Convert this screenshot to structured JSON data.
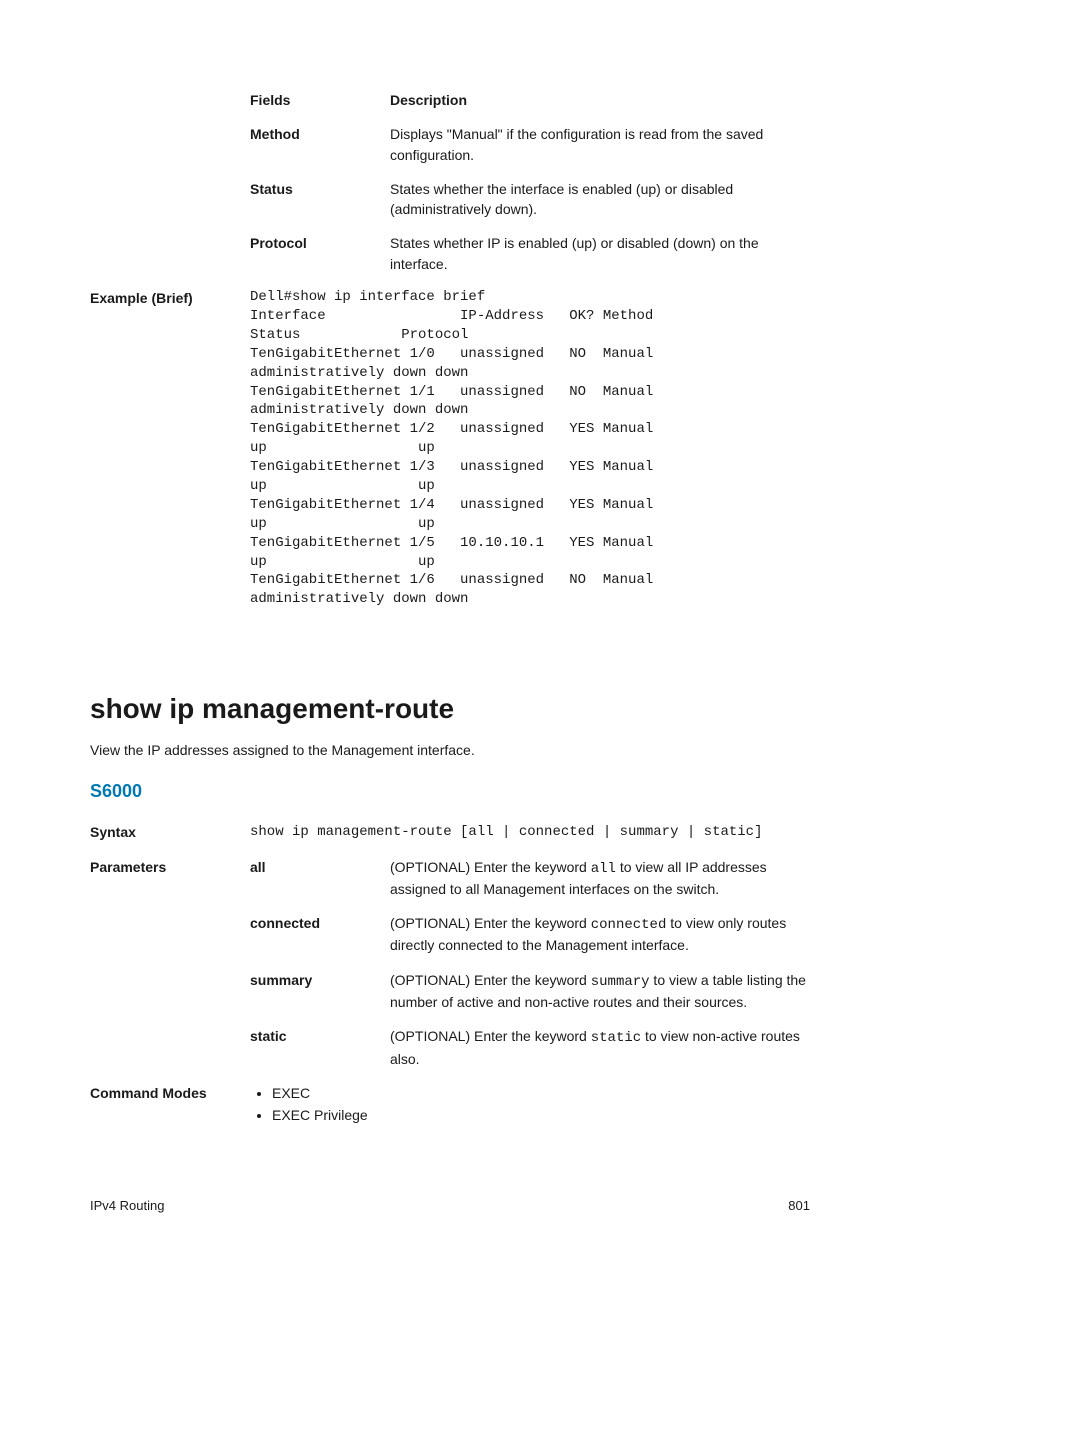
{
  "fields_table": {
    "header_fields": "Fields",
    "header_desc": "Description",
    "rows": [
      {
        "label": "Method",
        "desc": "Displays \"Manual\" if the configuration is read from the saved configuration."
      },
      {
        "label": "Status",
        "desc": "States whether the interface is enabled (up) or disabled (administratively down)."
      },
      {
        "label": "Protocol",
        "desc": "States whether IP is enabled (up) or disabled (down) on the interface."
      }
    ]
  },
  "example": {
    "label": "Example (Brief)",
    "code": "Dell#show ip interface brief\nInterface                IP-Address   OK? Method \nStatus            Protocol\nTenGigabitEthernet 1/0   unassigned   NO  Manual \nadministratively down down\nTenGigabitEthernet 1/1   unassigned   NO  Manual \nadministratively down down\nTenGigabitEthernet 1/2   unassigned   YES Manual \nup                  up\nTenGigabitEthernet 1/3   unassigned   YES Manual \nup                  up\nTenGigabitEthernet 1/4   unassigned   YES Manual \nup                  up\nTenGigabitEthernet 1/5   10.10.10.1   YES Manual \nup                  up\nTenGigabitEthernet 1/6   unassigned   NO  Manual \nadministratively down down"
  },
  "command": {
    "title": "show ip management-route",
    "intro": "View the IP addresses assigned to the Management interface.",
    "model": "S6000",
    "syntax_label": "Syntax",
    "syntax_code": "show ip management-route [all | connected | summary | static]",
    "parameters_label": "Parameters",
    "parameters": [
      {
        "name": "all",
        "desc_pre": "(OPTIONAL) Enter the keyword ",
        "kw": "all",
        "desc_post": " to view all IP addresses assigned to all Management interfaces on the switch."
      },
      {
        "name": "connected",
        "desc_pre": "(OPTIONAL) Enter the keyword ",
        "kw": "connected",
        "desc_post": " to view only routes directly connected to the Management interface."
      },
      {
        "name": "summary",
        "desc_pre": "(OPTIONAL) Enter the keyword ",
        "kw": "summary",
        "desc_post": " to view a table listing the number of active and non-active routes and their sources."
      },
      {
        "name": "static",
        "desc_pre": "(OPTIONAL) Enter the keyword ",
        "kw": "static",
        "desc_post": " to view non-active routes also."
      }
    ],
    "modes_label": "Command Modes",
    "modes": [
      "EXEC",
      "EXEC Privilege"
    ]
  },
  "footer": {
    "left": "IPv4 Routing",
    "right": "801"
  }
}
